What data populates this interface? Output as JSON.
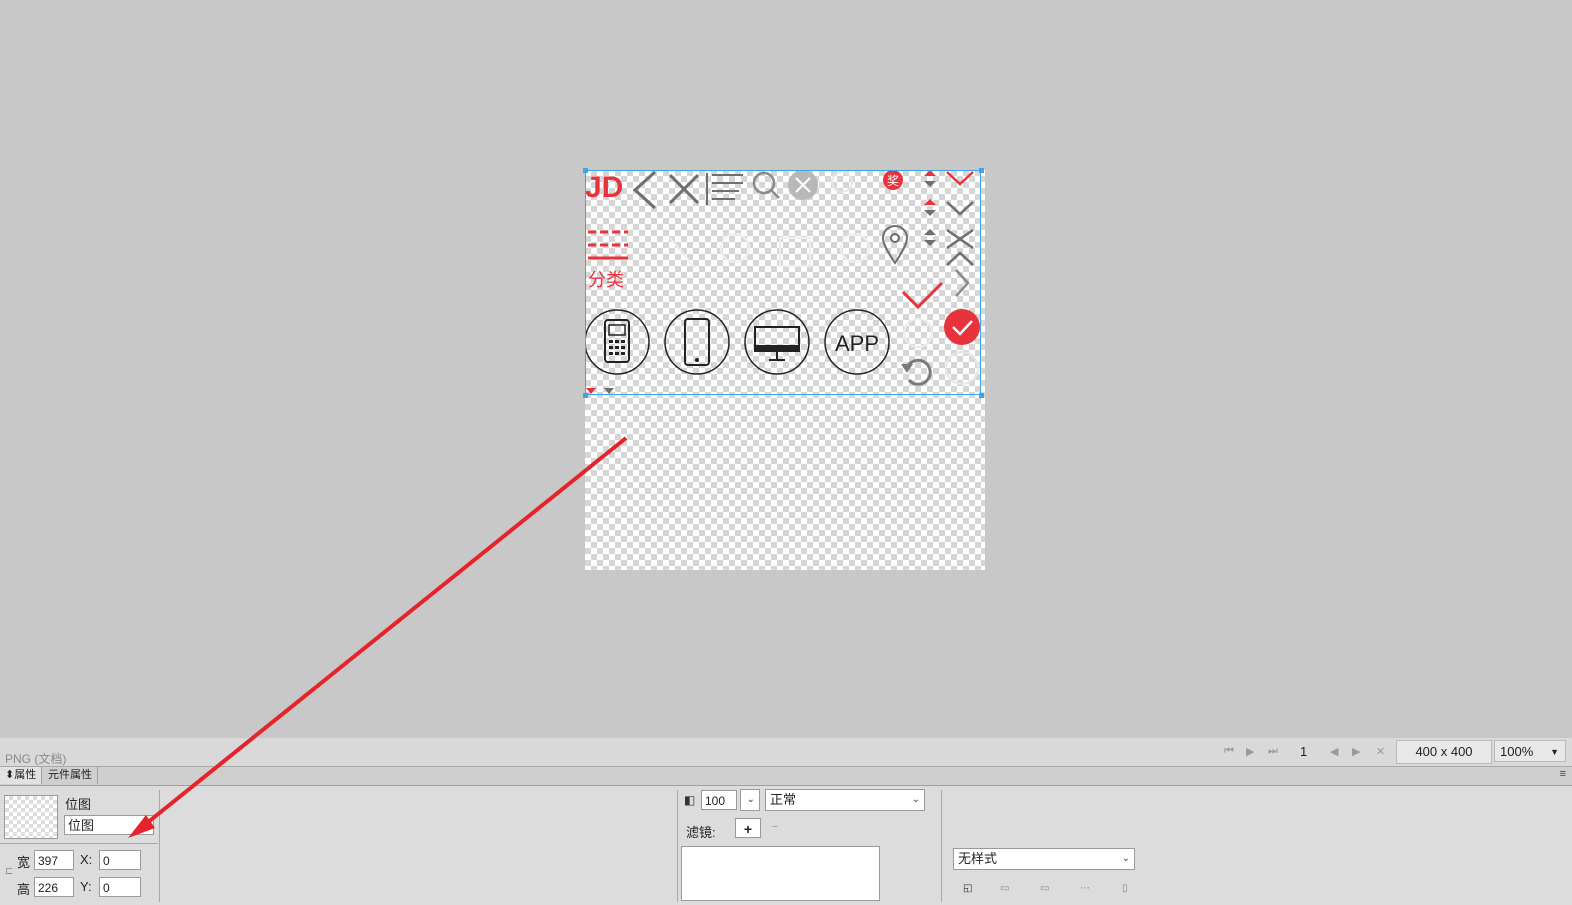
{
  "document": {
    "type_label": "PNG (文档)",
    "page_number": "1",
    "dimensions": "400 x 400",
    "zoom": "100%"
  },
  "panel": {
    "tab_properties": "属性",
    "tab_component_properties": "元件属性"
  },
  "properties": {
    "object_type": "位图",
    "object_name": "位图",
    "width_label": "宽",
    "width_value": "397",
    "height_label": "高",
    "height_value": "226",
    "x_label": "X:",
    "x_value": "0",
    "y_label": "Y:",
    "y_value": "0",
    "opacity_value": "100",
    "blend_mode": "正常",
    "filters_label": "滤镜:",
    "add_filter": "+",
    "remove_filter": "−",
    "style_value": "无样式"
  },
  "bitmap_text": {
    "logo": "JD",
    "category_label": "分类",
    "app_label": "APP",
    "badge": "奖"
  },
  "colors": {
    "accent_red": "#e8333c",
    "selection_blue": "#3fa3e8",
    "icon_gray": "#6f6f6f"
  }
}
